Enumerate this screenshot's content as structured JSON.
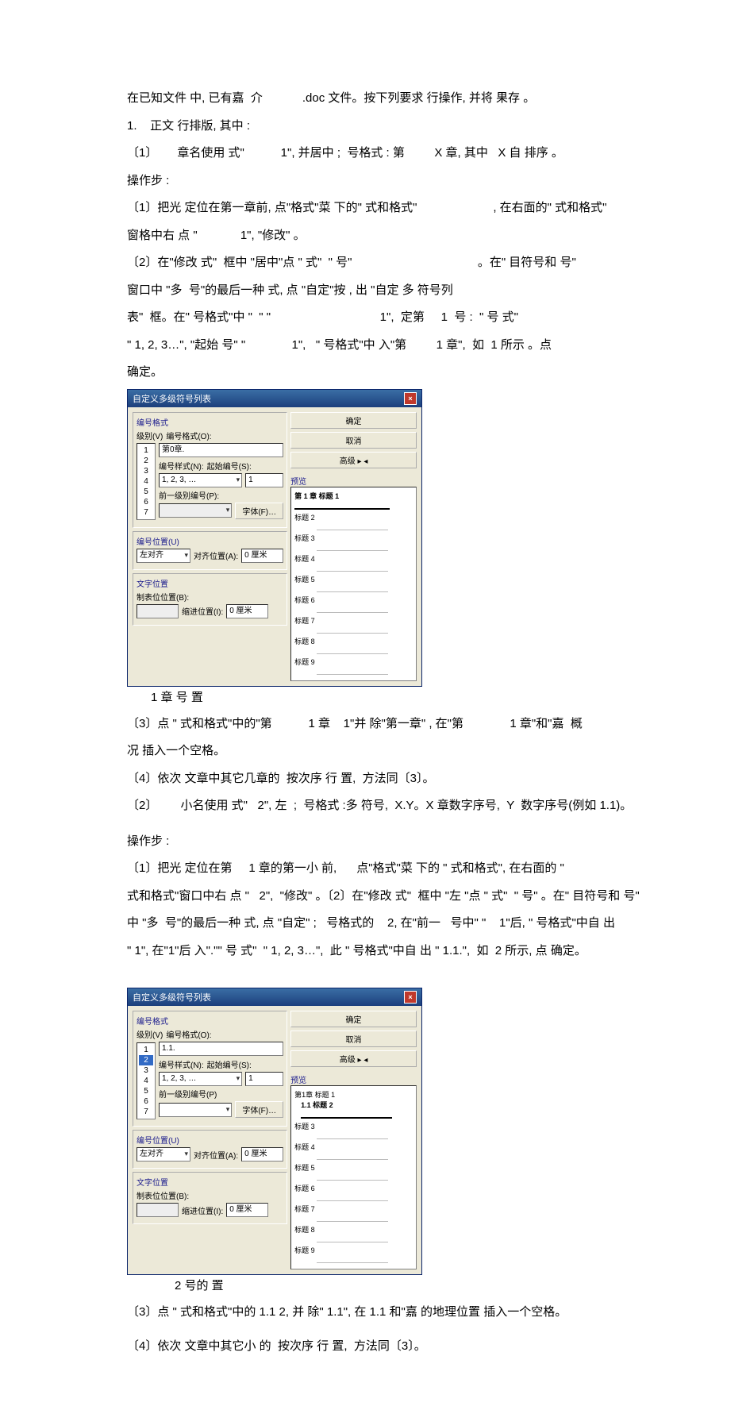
{
  "text": {
    "p01": "在已知文件 中, 已有嘉  介            .doc 文件。按下列要求 行操作, 并将 果存 。",
    "p02": "1.    正文 行排版, 其中 :",
    "p03": "〔1〕      章名使用 式\"           1\", 并居中 ;  号格式 : 第         X 章, 其中   X 自 排序 。",
    "p04": "操作步 :",
    "p05": "〔1〕把光 定位在第一章前, 点\"格式\"菜 下的\" 式和格式\"                       , 在右面的\" 式和格式\"",
    "p06": "窗格中右 点 \"             1\", \"修改\" 。",
    "p07": "〔2〕在\"修改 式\"  框中 \"居中\"点 \" 式\"  \" 号\"                                      。在\" 目符号和 号\"",
    "p08": "窗口中 \"多  号\"的最后一种 式, 点 \"自定\"按 , 出 \"自定 多 符号列",
    "p09": "表\"  框。在\" 号格式\"中 \"  \" \"                                 1\",  定第     1  号 :  \" 号 式\"",
    "p10": "\" 1, 2, 3…\", \"起始 号\" \"              1\",   \" 号格式\"中 入\"第         1 章\",  如  1 所示 。点",
    "p11": "确定。",
    "cap1": "1      章 号 置",
    "p12": "〔3〕点 \" 式和格式\"中的\"第           1 章    1\"并 除\"第一章\" , 在\"第              1 章\"和\"嘉  概",
    "p13": "况 插入一个空格。",
    "p14": "〔4〕依次 文章中其它几章的  按次序 行 置,  方法同〔3〕。",
    "p15": "〔2〕       小名使用 式\"   2\", 左  ;  号格式 :多 符号,  X.Y。X 章数字序号,  Y  数字序号(例如 1.1)。",
    "p16": "操作步 :",
    "p17": "〔1〕把光 定位在第     1 章的第一小 前,      点\"格式\"菜 下的 \" 式和格式\", 在右面的 \"",
    "p18": "式和格式\"窗口中右 点 \"   2\",  \"修改\" 。〔2〕在\"修改 式\"  框中 \"左 \"点 \" 式\"  \" 号\" 。在\" 目符号和 号\"",
    "p19": "中 \"多  号\"的最后一种 式, 点 \"自定\" ;   号格式的    2, 在\"前一   号中\" \"    1\"后, \" 号格式\"中自 出",
    "p20": "\" 1\", 在\"1\"后 入\".\"\" 号 式\"  \" 1, 2, 3…\",  此 \" 号格式\"中自 出 \" 1.1.\",  如  2 所示, 点 确定。",
    "cap2": "2    号的 置",
    "p21": "〔3〕点 \" 式和格式\"中的 1.1 2, 并 除\" 1.1\", 在 1.1 和\"嘉 的地理位置 插入一个空格。",
    "p22": "〔4〕依次 文章中其它小 的  按次序 行 置,  方法同〔3〕。"
  },
  "dialog1": {
    "title": "自定义多级符号列表",
    "group_format": "编号格式",
    "level_label": "级别(V)",
    "num_format_label": "编号格式(O):",
    "num_format_value": "第0章.",
    "num_style_label": "编号样式(N):",
    "num_style_value": "1, 2, 3, …",
    "start_at_label": "起始编号(S):",
    "start_at_value": "1",
    "prev_level_label": "前一级别编号(P):",
    "font_btn": "字体(F)…",
    "group_pos": "编号位置(U)",
    "align_value": "左对齐",
    "align_at_label": "对齐位置(A):",
    "align_at_value": "0 厘米",
    "group_textpos": "文字位置",
    "tab_label": "制表位位置(B):",
    "indent_label": "缩进位置(I):",
    "indent_value": "0 厘米",
    "ok_btn": "确定",
    "cancel_btn": "取消",
    "more_btn": "高级 ▸ ◂",
    "preview_label": "预览",
    "preview_item_prefix": "标题",
    "preview_heading": "第 1 章 标题 1"
  },
  "dialog2": {
    "title": "自定义多级符号列表",
    "num_format_value": "1.1.",
    "num_style_value": "1, 2, 3, …",
    "start_at_value": "1",
    "prev_level_value": "前一级别编号(P)",
    "preview_heading1": "第1章 标题 1",
    "preview_heading2": "1.1 标题 2",
    "preview_item_prefix": "标题"
  }
}
